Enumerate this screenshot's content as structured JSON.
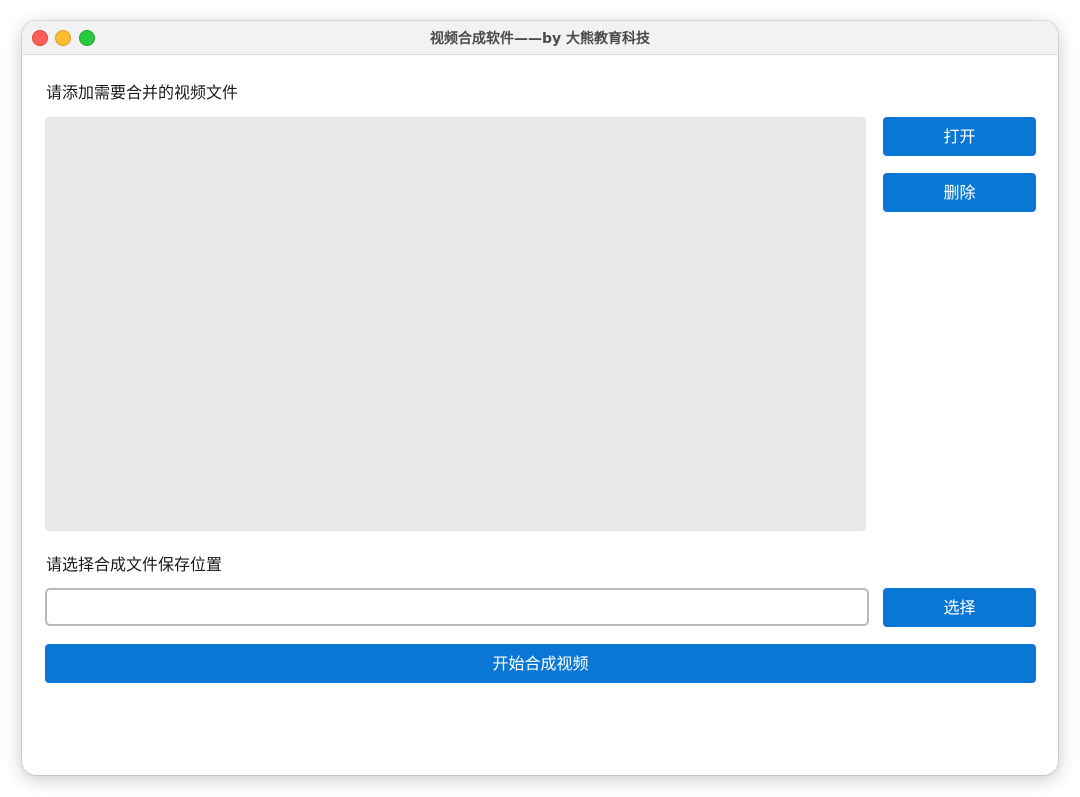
{
  "window": {
    "title": "视频合成软件——by 大熊教育科技"
  },
  "files_section": {
    "label": "请添加需要合并的视频文件",
    "items": [],
    "open_button": "打开",
    "delete_button": "删除"
  },
  "save_section": {
    "label": "请选择合成文件保存位置",
    "path_value": "",
    "choose_button": "选择"
  },
  "start_button": "开始合成视频",
  "colors": {
    "accent": "#0b77d4",
    "list_bg": "#e6e8e9",
    "close": "#ff5f57",
    "minimize": "#febc2e",
    "maximize": "#28c840"
  }
}
